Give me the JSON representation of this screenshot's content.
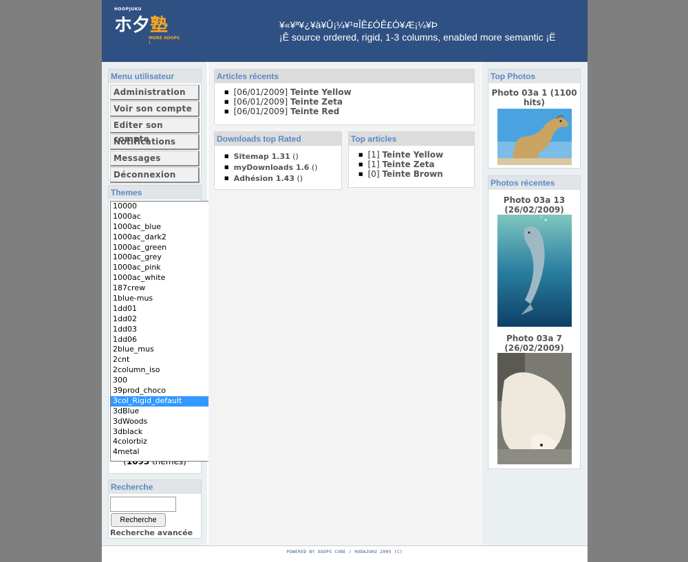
{
  "header": {
    "logo_small": "HOOPJUKU",
    "logo_text": "ホ夕",
    "logo_kanji": "塾",
    "logo_tag": "MORE XOOPS !",
    "line1": "¥«¥ª¥¿¥à¥Û¡¼¥¹¤ÎÊ£ÓÊ£Ó¥Æ¡¼¥Þ",
    "line2": "¡Ê source ordered, rigid, 1-3 columns, enabled more semantic ¡Ë"
  },
  "user_menu": {
    "title": "Menu utilisateur",
    "items": [
      "Administration",
      "Voir son compte",
      "Editer son compte",
      "Notifications",
      "Messages",
      "Déconnexion"
    ]
  },
  "themes": {
    "title": "Themes",
    "options": [
      "10000",
      "1000ac",
      "1000ac_blue",
      "1000ac_dark2",
      "1000ac_green",
      "1000ac_grey",
      "1000ac_pink",
      "1000ac_white",
      "187crew",
      "1blue-mus",
      "1dd01",
      "1dd02",
      "1dd03",
      "1dd06",
      "2blue_mus",
      "2cnt",
      "2column_iso",
      "300",
      "39prod_choco",
      "3col_Rigid_default",
      "3dBlue",
      "3dWoods",
      "3dblack",
      "4colorbiz",
      "4metal"
    ],
    "selected": "3col_Rigid_default",
    "count": "1093",
    "count_suffix": "thèmes"
  },
  "search": {
    "title": "Recherche",
    "button": "Recherche",
    "advanced": "Recherche avancée",
    "value": ""
  },
  "articles_recent": {
    "title": "Articles récents",
    "items": [
      {
        "date": "[06/01/2009]",
        "name": "Teinte Yellow"
      },
      {
        "date": "[06/01/2009]",
        "name": "Teinte Zeta"
      },
      {
        "date": "[06/01/2009]",
        "name": "Teinte Red"
      }
    ]
  },
  "downloads": {
    "title": "Downloads top Rated",
    "items": [
      {
        "name": "Sitemap 1.31",
        "extra": "()"
      },
      {
        "name": "myDownloads 1.6",
        "extra": "()"
      },
      {
        "name": "Adhésion 1.43",
        "extra": "()"
      }
    ]
  },
  "top_articles": {
    "title": "Top articles",
    "items": [
      {
        "count": "[1]",
        "name": "Teinte Yellow"
      },
      {
        "count": "[1]",
        "name": "Teinte Zeta"
      },
      {
        "count": "[0]",
        "name": "Teinte Brown"
      }
    ]
  },
  "top_photos": {
    "title": "Top Photos",
    "caption": "Photo 03a 1 (1100 hits)"
  },
  "recent_photos": {
    "title": "Photos récentes",
    "items": [
      {
        "caption": "Photo 03a 13 (26/02/2009)"
      },
      {
        "caption": "Photo 03a 7 (26/02/2009)"
      }
    ]
  },
  "footer": {
    "text": "POWERED BY XOOPS CUBE / HODAJUKU 2005 (C)"
  }
}
